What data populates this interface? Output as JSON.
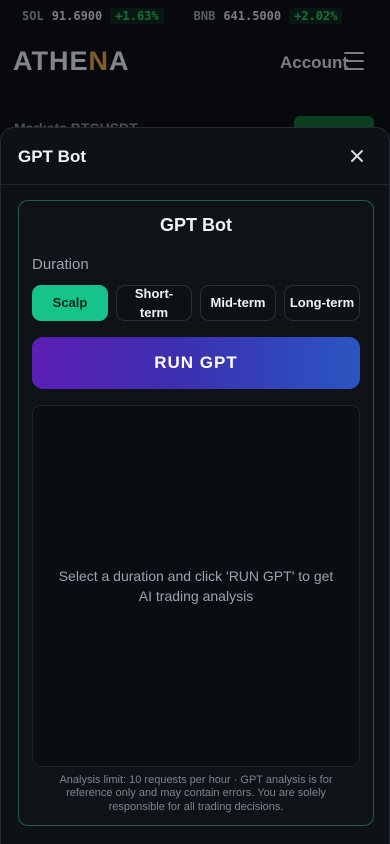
{
  "ticker": [
    {
      "symbol": "SOL",
      "price": "91.6900",
      "change": "+1.63%"
    },
    {
      "symbol": "BNB",
      "price": "641.5000",
      "change": "+2.02%"
    }
  ],
  "header": {
    "logo_prefix": "ATHE",
    "logo_accent": "N",
    "logo_suffix": "A",
    "account_label": "Account"
  },
  "background_row": {
    "text": "Markets BTCUSDT"
  },
  "modal": {
    "title": "GPT Bot",
    "card_title": "GPT Bot",
    "duration_label": "Duration",
    "durations": [
      {
        "label": "Scalp",
        "active": true
      },
      {
        "label": "Short-term",
        "active": false
      },
      {
        "label": "Mid-term",
        "active": false
      },
      {
        "label": "Long-term",
        "active": false
      }
    ],
    "run_label": "RUN GPT",
    "result_placeholder": "Select a duration and click 'RUN GPT' to get AI trading analysis",
    "disclaimer": "Analysis limit: 10 requests per hour · GPT analysis is for reference only and may contain errors. You are solely responsible for all trading decisions."
  },
  "colors": {
    "accent_green": "#16c38a",
    "run_gradient_start": "#5b1fb4",
    "run_gradient_end": "#2a56c2",
    "logo_accent": "#e0a23b"
  }
}
